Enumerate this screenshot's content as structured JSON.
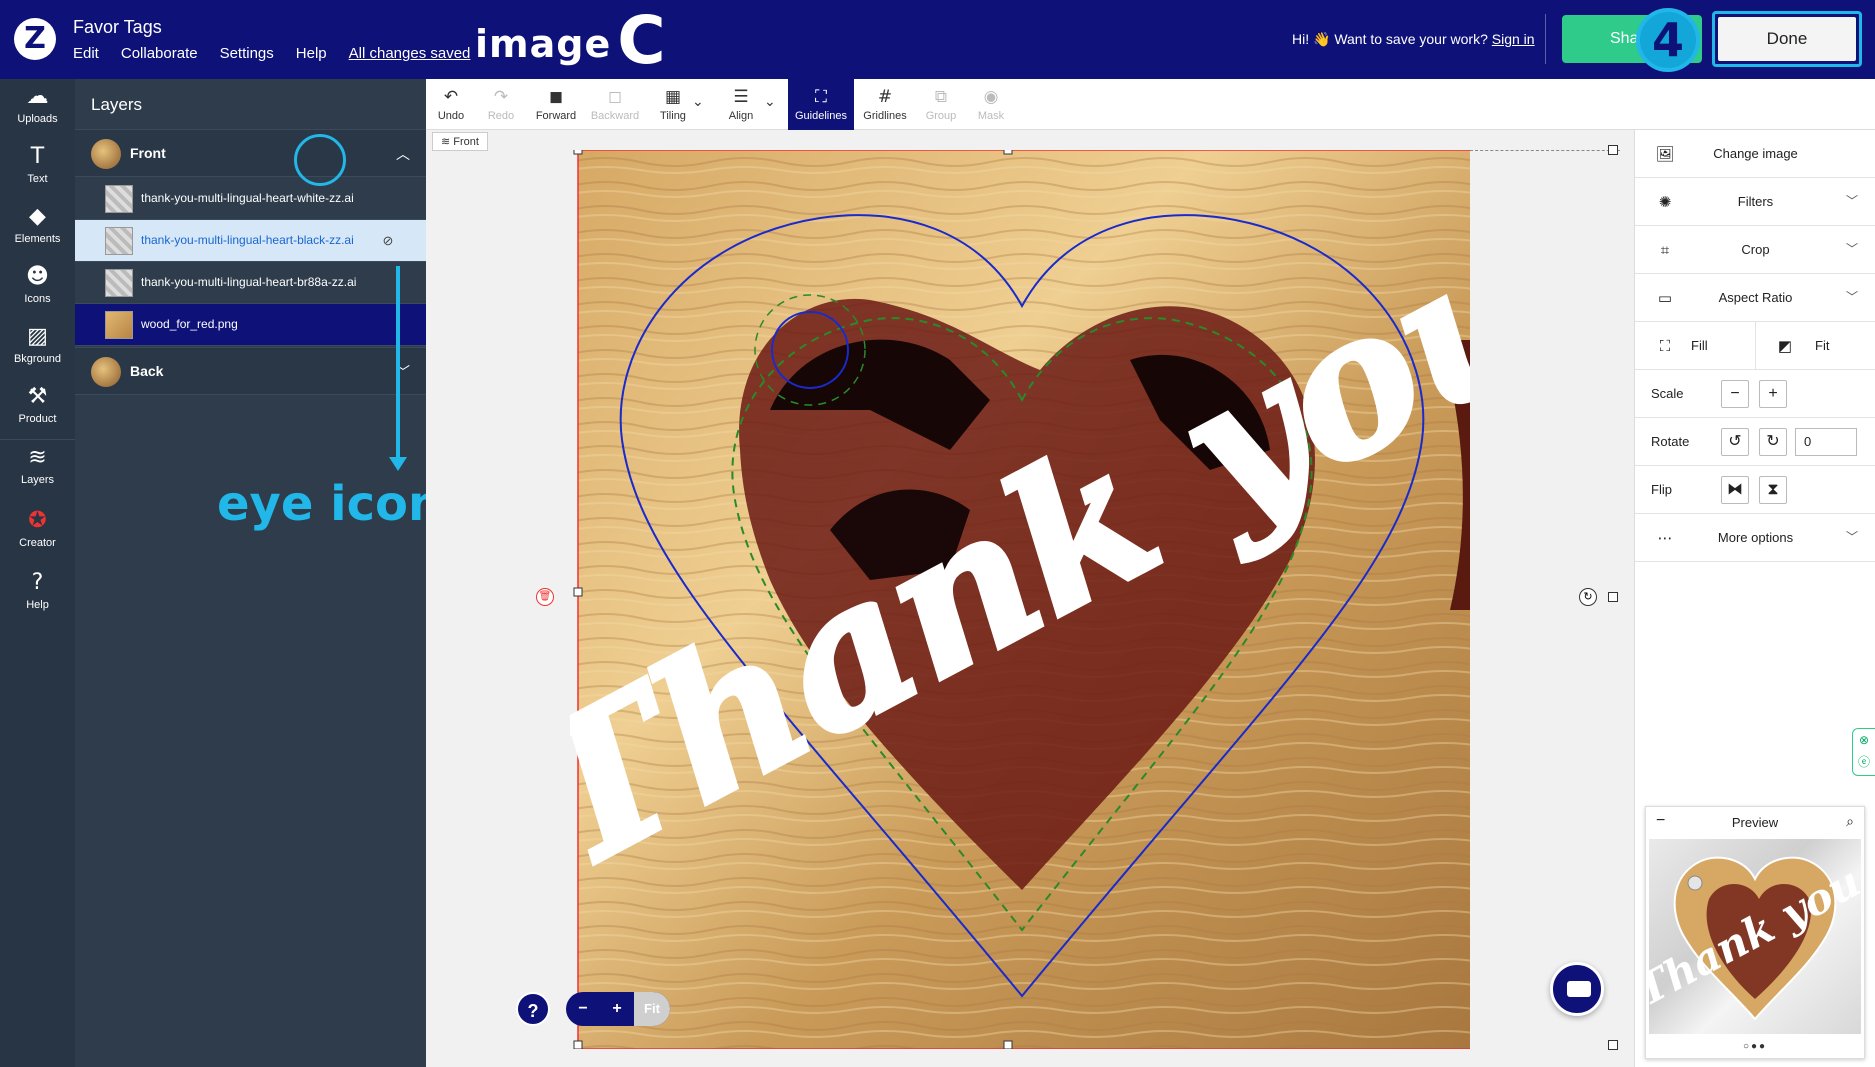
{
  "topbar": {
    "app_title": "Favor Tags",
    "menu": [
      "Edit",
      "Collaborate",
      "Settings",
      "Help"
    ],
    "save_status": "All changes saved",
    "image_label": "image",
    "image_letter": "C",
    "signin_prefix": "Hi! 👋 Want to save your work?",
    "signin_link": "Sign in",
    "share_label": "Share",
    "step_badge": "4",
    "done_label": "Done"
  },
  "rail": {
    "items": [
      {
        "label": "Uploads",
        "icon": "cloud-upload-icon",
        "glyph": "☁"
      },
      {
        "label": "Text",
        "icon": "text-icon",
        "glyph": "T"
      },
      {
        "label": "Elements",
        "icon": "shapes-icon",
        "glyph": "◆"
      },
      {
        "label": "Icons",
        "icon": "smiley-icon",
        "glyph": "☻"
      },
      {
        "label": "Bkground",
        "icon": "background-icon",
        "glyph": "▨"
      },
      {
        "label": "Product",
        "icon": "product-icon",
        "glyph": "⚒"
      },
      {
        "label": "Layers",
        "icon": "layers-icon",
        "glyph": "≋"
      },
      {
        "label": "Creator",
        "icon": "creator-icon",
        "glyph": "✪"
      },
      {
        "label": "Help",
        "icon": "help-icon",
        "glyph": "?"
      }
    ]
  },
  "layers": {
    "title": "Layers",
    "front_group": "Front",
    "back_group": "Back",
    "rows": [
      {
        "name": "thank-you-multi-lingual-heart-white-zz.ai",
        "state": "normal"
      },
      {
        "name": "thank-you-multi-lingual-heart-black-zz.ai",
        "state": "selected"
      },
      {
        "name": "thank-you-multi-lingual-heart-br88a-zz.ai",
        "state": "normal"
      },
      {
        "name": "wood_for_red.png",
        "state": "active"
      }
    ],
    "annotation": "eye icon"
  },
  "toolbar": {
    "tools": [
      {
        "label": "Undo",
        "glyph": "↶",
        "state": "normal"
      },
      {
        "label": "Redo",
        "glyph": "↷",
        "state": "disabled"
      },
      {
        "label": "Forward",
        "glyph": "◼",
        "state": "normal"
      },
      {
        "label": "Backward",
        "glyph": "◻",
        "state": "disabled"
      },
      {
        "label": "Tiling",
        "glyph": "▦",
        "state": "normal"
      },
      {
        "label": "Align",
        "glyph": "☰",
        "state": "normal"
      },
      {
        "label": "Guidelines",
        "glyph": "⛶",
        "state": "on"
      },
      {
        "label": "Gridlines",
        "glyph": "#",
        "state": "normal"
      },
      {
        "label": "Group",
        "glyph": "⧉",
        "state": "disabled"
      },
      {
        "label": "Mask",
        "glyph": "◉",
        "state": "disabled"
      }
    ]
  },
  "canvas": {
    "side_tag": "Front",
    "art_text": "Thank you",
    "zoom_minus": "−",
    "zoom_plus": "+",
    "zoom_fit": "Fit",
    "help_glyph": "?"
  },
  "right_panel": {
    "change_image": "Change image",
    "filters": "Filters",
    "crop": "Crop",
    "aspect_ratio": "Aspect Ratio",
    "fill": "Fill",
    "fit": "Fit",
    "scale": "Scale",
    "rotate": "Rotate",
    "rotate_value": "0",
    "flip": "Flip",
    "more_options": "More options",
    "preview_title": "Preview"
  },
  "colors": {
    "navy": "#0d1178",
    "accent_cyan": "#21b7e8",
    "share_green": "#2ecb8a",
    "panel_dark": "#2e3c4c"
  }
}
